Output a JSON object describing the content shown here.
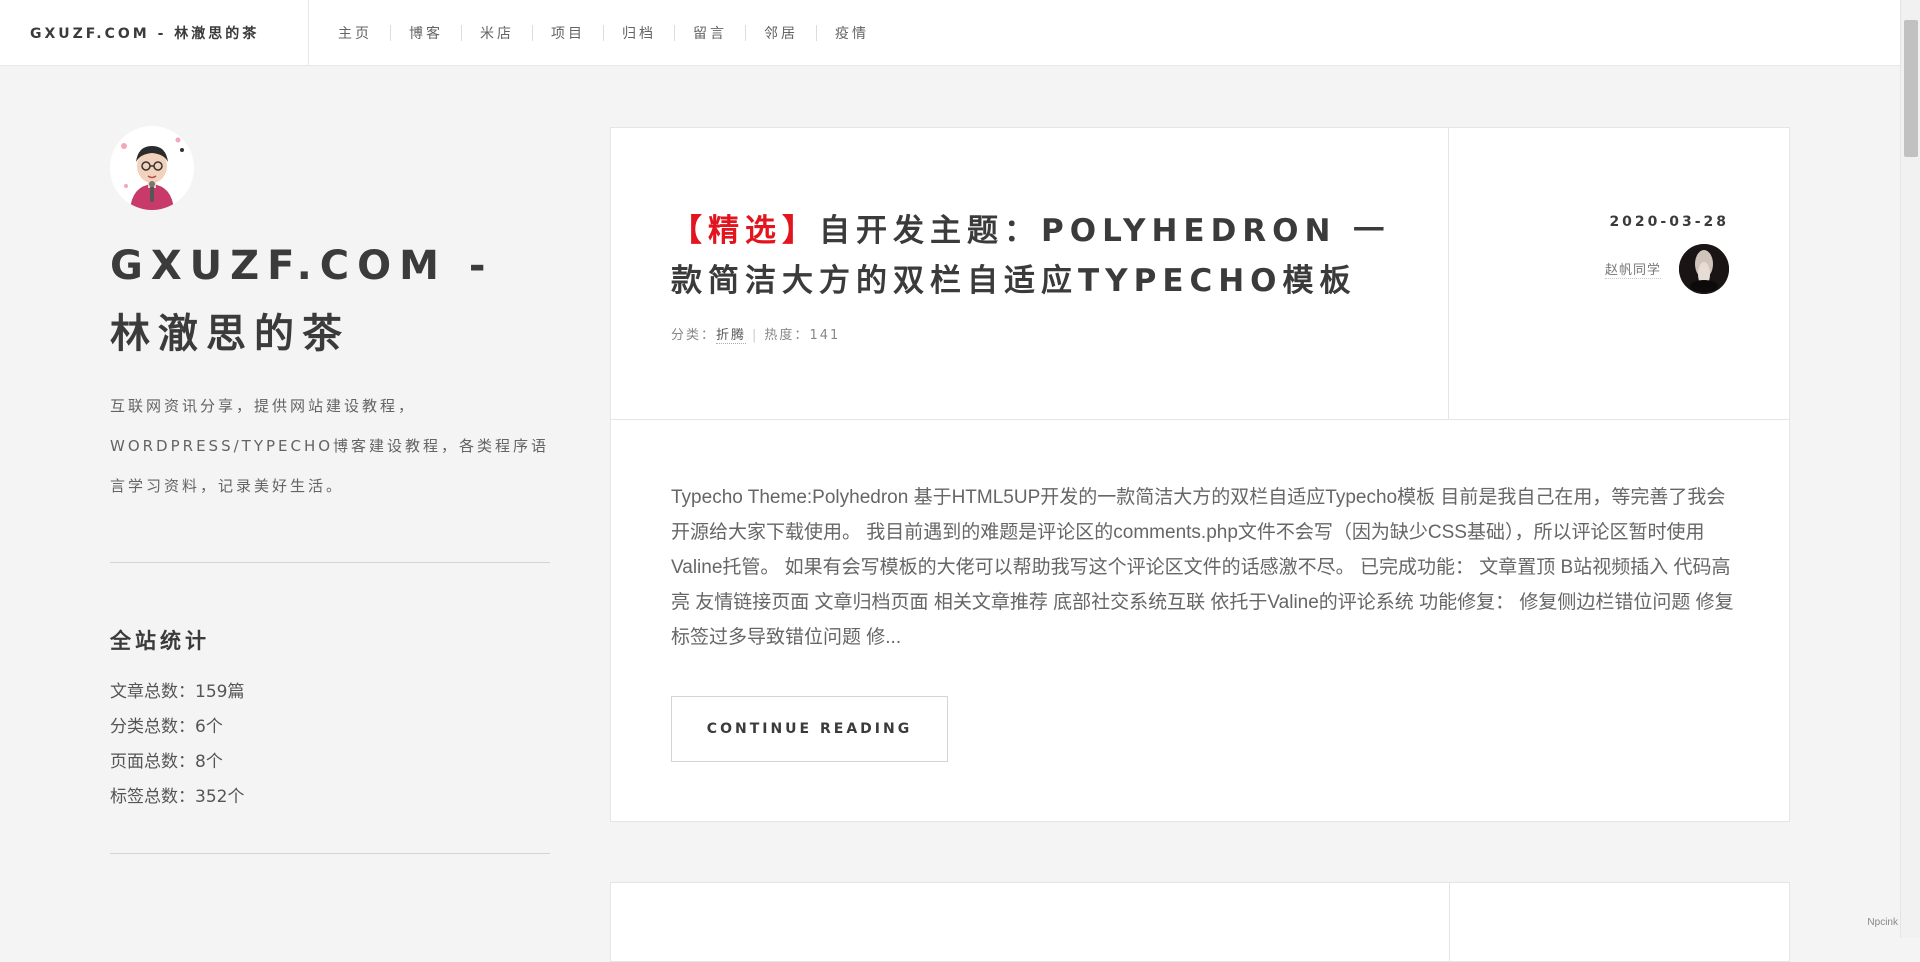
{
  "header": {
    "brand": "GXUZF.COM - 林澈思的茶",
    "nav": [
      "主页",
      "博客",
      "米店",
      "项目",
      "归档",
      "留言",
      "邻居",
      "疫情"
    ]
  },
  "sidebar": {
    "title": "GXUZF.COM - 林澈思的茶",
    "description": "互联网资讯分享，提供网站建设教程，WORDPRESS/TYPECHO博客建设教程，各类程序语言学习资料，记录美好生活。",
    "stats_title": "全站统计",
    "stats": [
      "文章总数：159篇",
      "分类总数：6个",
      "页面总数：8个",
      "标签总数：352个"
    ]
  },
  "post": {
    "tag": "【精选】",
    "title": "自开发主题：POLYHEDRON 一款简洁大方的双栏自适应TYPECHO模板",
    "meta_category_label": "分类：",
    "meta_category": "折腾",
    "meta_sep": "|",
    "meta_heat_label": "热度：",
    "meta_heat": "141",
    "date": "2020-03-28",
    "author": "赵帆同学",
    "excerpt": "Typecho Theme:Polyhedron 基于HTML5UP开发的一款简洁大方的双栏自适应Typecho模板 目前是我自己在用，等完善了我会开源给大家下载使用。 我目前遇到的难题是评论区的comments.php文件不会写（因为缺少CSS基础），所以评论区暂时使用Valine托管。 如果有会写模板的大佬可以帮助我写这个评论区文件的话感激不尽。 已完成功能： 文章置顶 B站视频插入 代码高亮 友情链接页面 文章归档页面 相关文章推荐 底部社交系统互联 依托于Valine的评论系统 功能修复： 修复侧边栏错位问题 修复标签过多导致错位问题 修...",
    "continue_label": "CONTINUE READING"
  },
  "watermark": "Npcink",
  "colors": {
    "accent_red": "#e2151f",
    "text_dark": "#3c3b3b",
    "background": "#f4f4f4"
  }
}
